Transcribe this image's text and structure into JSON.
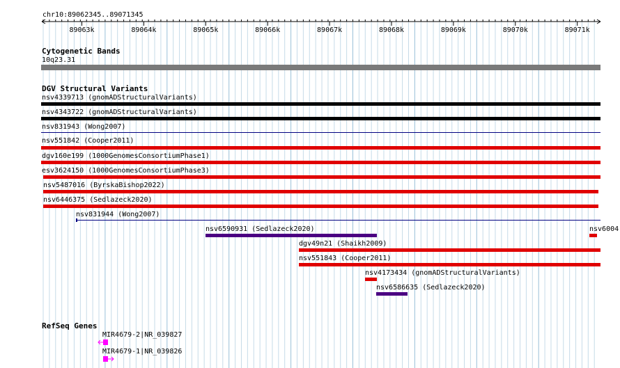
{
  "ruler": {
    "locus": "chr10:89062345..89071345",
    "ticks": [
      "89063k",
      "89064k",
      "89065k",
      "89066k",
      "89067k",
      "89068k",
      "89069k",
      "89070k",
      "89071k"
    ]
  },
  "cytobands": {
    "title": "Cytogenetic Bands",
    "band": "10q23.31"
  },
  "dgv": {
    "title": "DGV Structural Variants",
    "items": [
      {
        "label": "nsv4339713 (gnomADStructuralVariants)",
        "color": "#000000"
      },
      {
        "label": "nsv4343722 (gnomADStructuralVariants)",
        "color": "#000000"
      },
      {
        "label": "nsv831943 (Wong2007)",
        "color": "#000080"
      },
      {
        "label": "nsv551842 (Cooper2011)",
        "color": "#e00000"
      },
      {
        "label": "dgv160e199 (1000GenomesConsortiumPhase1)",
        "color": "#e00000"
      },
      {
        "label": "esv3624150 (1000GenomesConsortiumPhase3)",
        "color": "#e00000"
      },
      {
        "label": "nsv5487016 (ByrskaBishop2022)",
        "color": "#e00000"
      },
      {
        "label": "nsv6446375 (Sedlazeck2020)",
        "color": "#e00000"
      },
      {
        "label": "nsv831944 (Wong2007)",
        "color": "#000080"
      },
      {
        "label": "nsv6590931 (Sedlazeck2020)",
        "color": "#4b0082"
      },
      {
        "label": "nsv6004",
        "color": "#e00000"
      },
      {
        "label": "dgv49n21 (Shaikh2009)",
        "color": "#e00000"
      },
      {
        "label": "nsv551843 (Cooper2011)",
        "color": "#e00000"
      },
      {
        "label": "nsv4173434 (gnomADStructuralVariants)",
        "color": "#e00000"
      },
      {
        "label": "nsv6586635 (Sedlazeck2020)",
        "color": "#4b0082"
      }
    ]
  },
  "refseq": {
    "title": "RefSeq Genes",
    "items": [
      {
        "label": "MIR4679-2|NR_039827",
        "color": "#ff00ff"
      },
      {
        "label": "MIR4679-1|NR_039826",
        "color": "#ff00ff"
      }
    ]
  }
}
